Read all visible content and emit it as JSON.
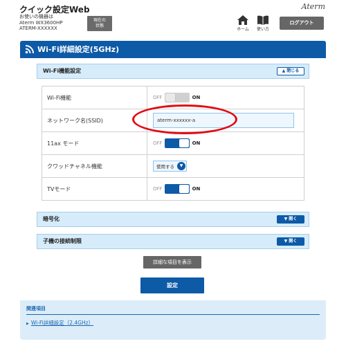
{
  "header": {
    "app_title": "クイック設定Web",
    "device_caption": "お使いの機器は",
    "device_model": "Aterm WX3600HP",
    "device_ssid": "ATERM-XXXXXX",
    "status_button": "現在の\n状態",
    "brand": "Aterm",
    "home_label": "ホーム",
    "help_label": "使い方",
    "logout_label": "ログアウト"
  },
  "page": {
    "title": "Wi-Fi詳細設定(5GHz)"
  },
  "section_wifi": {
    "title": "Wi-Fi機能設定",
    "close_label": "閉じる"
  },
  "settings": [
    {
      "label": "Wi-Fi機能",
      "off": "OFF",
      "on": "ON",
      "state": "off"
    },
    {
      "label": "ネットワーク名(SSID)",
      "value": "aterm-xxxxxx-a"
    },
    {
      "label": "11ax モード",
      "off": "OFF",
      "on": "ON",
      "state": "on"
    },
    {
      "label": "クワッドチャネル機能",
      "select_value": "使用する"
    },
    {
      "label": "TVモード",
      "off": "OFF",
      "on": "ON",
      "state": "on"
    }
  ],
  "section_encryption": {
    "title": "暗号化",
    "open_label": "開く"
  },
  "section_child": {
    "title": "子機の接続制限",
    "open_label": "開く"
  },
  "buttons": {
    "detail": "詳細な項目を表示",
    "submit": "設定"
  },
  "related": {
    "title": "関連項目",
    "link": "Wi-Fi詳細設定（2.4GHz）"
  },
  "colors": {
    "primary": "#0d5aa7",
    "section_bg": "#d6ecfa",
    "highlight": "#e10b14"
  }
}
